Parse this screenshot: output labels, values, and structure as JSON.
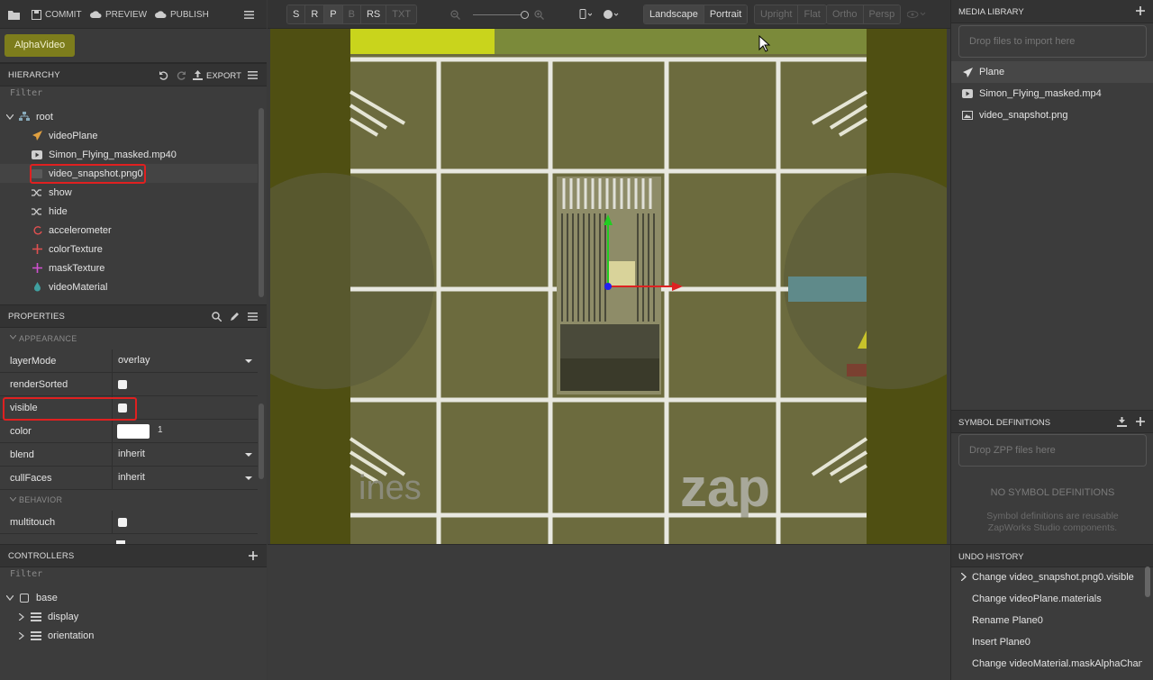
{
  "topbar": {
    "commit": "COMMIT",
    "preview": "PREVIEW",
    "publish": "PUBLISH"
  },
  "project": {
    "name": "AlphaVideo"
  },
  "hierarchy": {
    "title": "HIERARCHY",
    "export_label": "EXPORT",
    "filter_placeholder": "Filter",
    "root": "root",
    "items": [
      {
        "label": "videoPlane",
        "icon": "plane-icon",
        "color": "#e0a040"
      },
      {
        "label": "Simon_Flying_masked.mp40",
        "icon": "video-icon",
        "color": "#cfcfcf"
      },
      {
        "label": "video_snapshot.png0",
        "icon": "image-icon",
        "color": "#5a5a5a"
      },
      {
        "label": "show",
        "icon": "shuffle-icon",
        "color": "#cfcfcf"
      },
      {
        "label": "hide",
        "icon": "shuffle-icon",
        "color": "#cfcfcf"
      },
      {
        "label": "accelerometer",
        "icon": "refresh-icon",
        "color": "#e05050"
      },
      {
        "label": "colorTexture",
        "icon": "move-icon",
        "color": "#e05050"
      },
      {
        "label": "maskTexture",
        "icon": "move-icon",
        "color": "#d050d0"
      },
      {
        "label": "videoMaterial",
        "icon": "drop-icon",
        "color": "#40a0a0"
      }
    ]
  },
  "properties": {
    "title": "PROPERTIES",
    "appearance_label": "APPEARANCE",
    "behavior_label": "BEHAVIOR",
    "rows": {
      "layerMode": {
        "label": "layerMode",
        "value": "overlay"
      },
      "renderSorted": {
        "label": "renderSorted"
      },
      "visible": {
        "label": "visible"
      },
      "color": {
        "label": "color",
        "value": "1"
      },
      "blend": {
        "label": "blend",
        "value": "inherit"
      },
      "cullFaces": {
        "label": "cullFaces",
        "value": "inherit"
      },
      "multitouch": {
        "label": "multitouch"
      }
    }
  },
  "controllers": {
    "title": "CONTROLLERS",
    "filter_placeholder": "Filter",
    "base": "base",
    "items": [
      "display",
      "orientation"
    ]
  },
  "toolbar": {
    "transform": [
      "S",
      "R",
      "P",
      "B",
      "RS",
      "TXT"
    ],
    "landscape": "Landscape",
    "portrait": "Portrait",
    "upright": "Upright",
    "flat": "Flat",
    "ortho": "Ortho",
    "persp": "Persp"
  },
  "viewport": {
    "logo_text": "zap",
    "side_text": "ines"
  },
  "media": {
    "title": "MEDIA LIBRARY",
    "drop_text": "Drop files to import here",
    "items": [
      {
        "label": "Plane",
        "icon": "plane-icon"
      },
      {
        "label": "Simon_Flying_masked.mp4",
        "icon": "video-icon"
      },
      {
        "label": "video_snapshot.png",
        "icon": "image-icon"
      }
    ]
  },
  "symbols": {
    "title": "SYMBOL DEFINITIONS",
    "drop_text": "Drop ZPP files here",
    "empty_title": "NO SYMBOL DEFINITIONS",
    "empty_desc_1": "Symbol definitions are reusable",
    "empty_desc_2": "ZapWorks Studio components."
  },
  "undo": {
    "title": "UNDO HISTORY",
    "items": [
      "Change video_snapshot.png0.visible",
      "Change videoPlane.materials",
      "Rename Plane0",
      "Insert Plane0",
      "Change videoMaterial.maskAlphaChannel"
    ]
  },
  "colors": {
    "accent_project": "#7d7d1c",
    "highlight": "#e02020",
    "viewport_bg": "#4f4f12"
  }
}
